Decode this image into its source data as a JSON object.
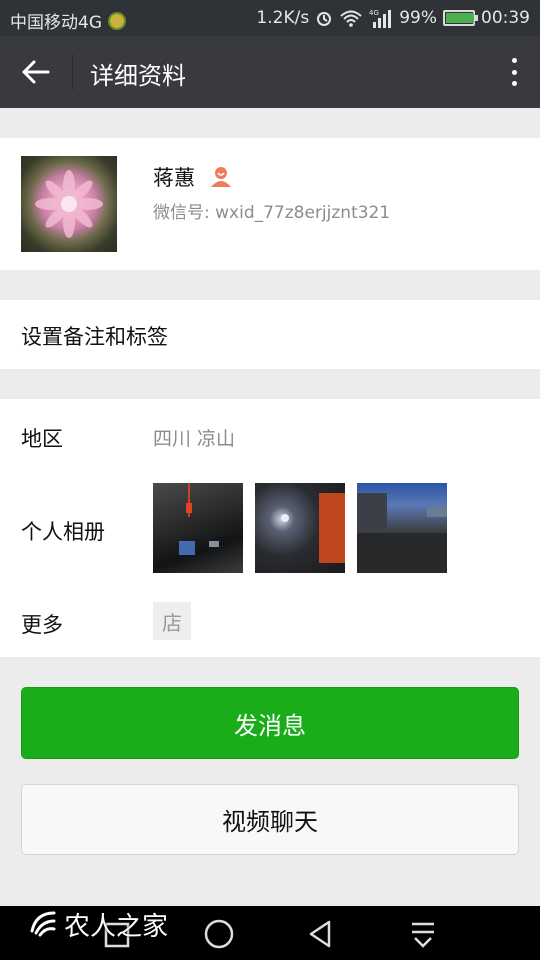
{
  "status_bar": {
    "carrier": "中国移动4G",
    "speed": "1.2K/s",
    "battery_percent": "99%",
    "battery_level": 0.99,
    "time": "00:39",
    "icons": [
      "app-icon",
      "alarm-icon",
      "wifi-icon",
      "signal-icon",
      "battery-icon"
    ]
  },
  "header": {
    "title": "详细资料",
    "back_icon": "arrow-left-icon",
    "more_icon": "more-vertical-icon"
  },
  "profile": {
    "name": "蒋蕙",
    "wechat_id": "微信号: wxid_77z8erjjznt321",
    "gender_icon": "female-icon"
  },
  "remark": {
    "label": "设置备注和标签"
  },
  "info": {
    "region_label": "地区",
    "region_value": "四川  凉山",
    "album_label": "个人相册",
    "more_label": "更多",
    "store_badge": "店"
  },
  "actions": {
    "send_message": "发消息",
    "video_chat": "视频聊天"
  },
  "nav": {
    "icons": [
      "square-icon",
      "home-circle-icon",
      "back-triangle-icon",
      "download-icon"
    ]
  },
  "watermark": {
    "text": "农人之家"
  },
  "colors": {
    "primary_green": "#1aad19",
    "header_bg": "#393a3f",
    "status_bg": "#2f3236",
    "page_bg": "#ececec"
  }
}
